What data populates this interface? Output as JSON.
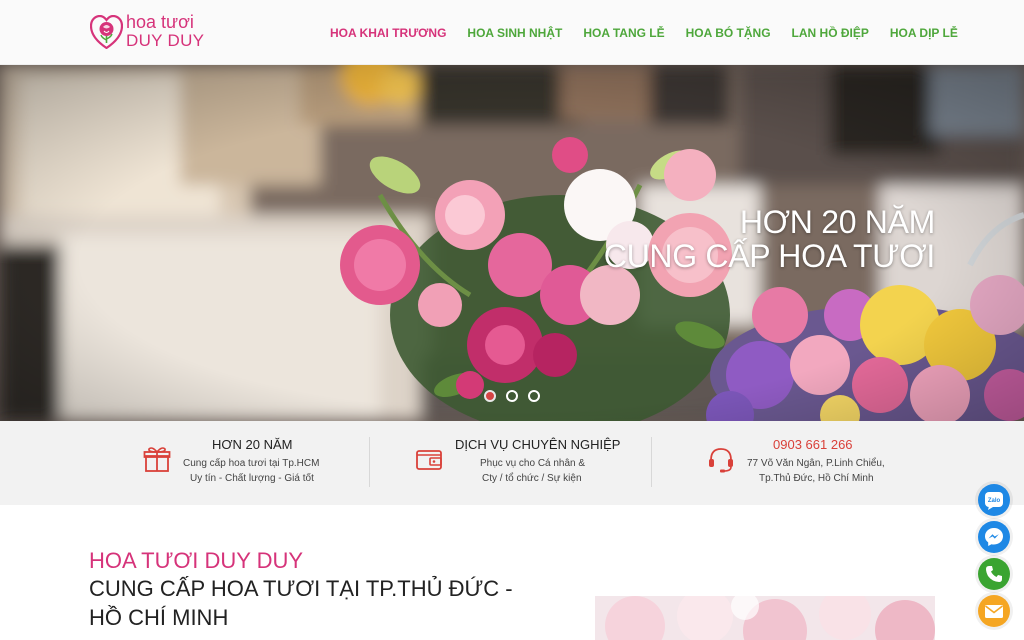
{
  "logo": {
    "line1": "hoa tươi",
    "line2": "DUY DUY",
    "icon": "rose-logo-icon"
  },
  "nav": [
    {
      "label": "HOA KHAI TRƯƠNG",
      "active": true
    },
    {
      "label": "HOA SINH NHẬT",
      "active": false
    },
    {
      "label": "HOA TANG LỄ",
      "active": false
    },
    {
      "label": "HOA BÓ TẶNG",
      "active": false
    },
    {
      "label": "LAN HỒ ĐIỆP",
      "active": false
    },
    {
      "label": "HOA DỊP LỄ",
      "active": false
    }
  ],
  "hero": {
    "line1": "HƠN 20 NĂM",
    "line2": "CUNG CẤP HOA TƯƠI",
    "slides": 3,
    "active_slide": 1
  },
  "features": [
    {
      "icon": "gift-icon",
      "title": "HƠN 20 NĂM",
      "lines": [
        "Cung cấp hoa tươi tại Tp.HCM",
        "Uy tín - Chất lượng - Giá tốt"
      ]
    },
    {
      "icon": "wallet-icon",
      "title": "DỊCH VỤ CHUYÊN NGHIỆP",
      "lines": [
        "Phục vụ cho Cá nhân &",
        "Cty / tổ chức / Sự kiện"
      ]
    },
    {
      "icon": "headset-icon",
      "title": "0903 661 266",
      "lines": [
        "77 Võ Văn Ngân, P.Linh Chiểu,",
        "Tp.Thủ Đức, Hồ Chí Minh"
      ]
    }
  ],
  "intro": {
    "brand": "HOA TƯƠI DUY DUY",
    "heading": "CUNG CẤP HOA TƯƠI TẠI TP.THỦ ĐỨC - HỒ CHÍ MINH"
  },
  "floating": {
    "zalo_label": "Zalo",
    "buttons": [
      "zalo-icon",
      "messenger-icon",
      "phone-icon",
      "mail-icon"
    ]
  },
  "colors": {
    "brand_pink": "#d6337a",
    "nav_green": "#4ea73b",
    "feature_red": "#d9413a"
  }
}
